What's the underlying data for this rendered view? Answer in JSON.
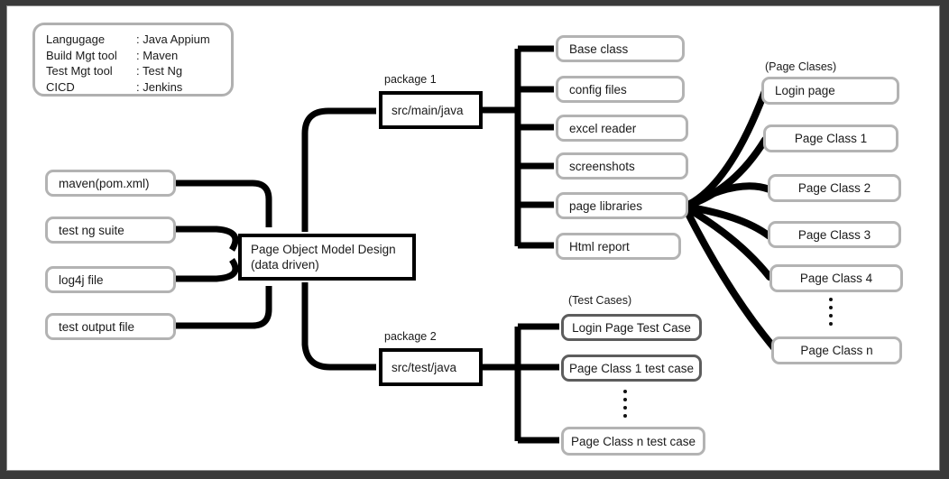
{
  "legend": {
    "name": "tech-stack-legend",
    "rows": [
      {
        "key": "Langugage",
        "value": ": Java Appium"
      },
      {
        "key": "Build Mgt tool",
        "value": ": Maven"
      },
      {
        "key": "Test Mgt tool",
        "value": ": Test Ng"
      },
      {
        "key": "CICD",
        "value": ": Jenkins"
      }
    ]
  },
  "inputs": [
    {
      "label": "maven(pom.xml)"
    },
    {
      "label": "test ng suite"
    },
    {
      "label": "log4j file"
    },
    {
      "label": "test output file"
    }
  ],
  "center": {
    "line1": "Page Object Model Design",
    "line2": "(data driven)"
  },
  "packages": [
    {
      "label": "package 1",
      "box": "src/main/java"
    },
    {
      "label": "package 2",
      "box": "src/test/java"
    }
  ],
  "main_java_children": [
    {
      "label": "Base class"
    },
    {
      "label": "config files"
    },
    {
      "label": "excel reader"
    },
    {
      "label": "screenshots"
    },
    {
      "label": "page libraries"
    },
    {
      "label": "Html report"
    }
  ],
  "test_cases": {
    "group_label": "(Test Cases)",
    "items": [
      {
        "label": "Login Page Test Case"
      },
      {
        "label": "Page Class 1 test case"
      },
      {
        "label": "Page Class n test case"
      }
    ]
  },
  "page_classes": {
    "group_label": "(Page Clases)",
    "items": [
      {
        "label": "Login page"
      },
      {
        "label": "Page Class 1"
      },
      {
        "label": "Page Class 2"
      },
      {
        "label": "Page Class 3"
      },
      {
        "label": "Page Class 4"
      },
      {
        "label": "Page Class n"
      }
    ]
  },
  "colors": {
    "frame": "#3a3a3a",
    "canvas": "#ffffff",
    "node_border": "#b3b3b3",
    "hard_border": "#000000",
    "wire": "#000000"
  }
}
